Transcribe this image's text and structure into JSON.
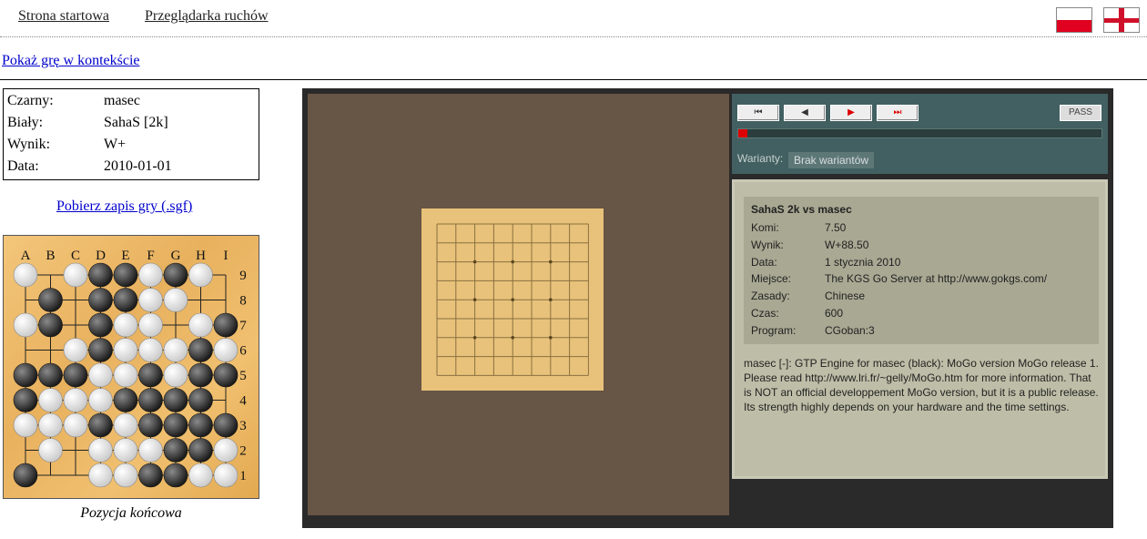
{
  "nav": {
    "home": "Strona startowa",
    "browser": "Przeglądarka ruchów"
  },
  "flags": [
    "pl-flag-icon",
    "en-flag-icon"
  ],
  "context_link": "Pokaż grę w kontekście",
  "game": {
    "black_label": "Czarny:",
    "black": "masec",
    "white_label": "Biały:",
    "white": "SahaS [2k]",
    "result_label": "Wynik:",
    "result": "W+",
    "date_label": "Data:",
    "date": "2010-01-01"
  },
  "sgf_link": "Pobierz zapis gry (.sgf)",
  "final_board": {
    "columns": [
      "A",
      "B",
      "C",
      "D",
      "E",
      "F",
      "G",
      "H",
      "I"
    ],
    "rows": [
      "9",
      "8",
      "7",
      "6",
      "5",
      "4",
      "3",
      "2",
      "1"
    ],
    "position": [
      "W.WBBWBW.",
      ".B.BBWW..",
      "WB.BWW.WB",
      "..WBWWWBW",
      "BBBWWBWBB",
      "BWWWBBBB.",
      "WWWBWBBBB",
      ".W.WWWBBW",
      "B..WWBBWW"
    ],
    "caption": "Pozycja końcowa"
  },
  "viewer": {
    "board_size": 9,
    "pass_label": "PASS",
    "progress": 0.025,
    "variants_label": "Warianty:",
    "variants_value": "Brak wariantów",
    "info_title": "SahaS 2k vs masec",
    "info": [
      {
        "k": "Komi:",
        "v": "7.50"
      },
      {
        "k": "Wynik:",
        "v": "W+88.50"
      },
      {
        "k": "Data:",
        "v": "1 stycznia 2010"
      },
      {
        "k": "Miejsce:",
        "v": "The KGS Go Server at http://www.gokgs.com/"
      },
      {
        "k": "Zasady:",
        "v": "Chinese"
      },
      {
        "k": "Czas:",
        "v": "600"
      },
      {
        "k": "Program:",
        "v": "CGoban:3"
      }
    ],
    "comment": "masec [-]: GTP Engine for masec (black): MoGo version MoGo release 1. Please read http://www.lri.fr/~gelly/MoGo.htm for more information. That is NOT an official developpement MoGo version, but it is a public release. Its strength highly depends on your hardware and the time settings."
  },
  "colors": {
    "link": "#0000cc",
    "viewer_bg": "#2a2a2a",
    "board_bg": "#675545",
    "goban": "#e8c27a",
    "controls": "#426061",
    "info_bg": "#bebea8",
    "accent_red": "#dd0000"
  }
}
